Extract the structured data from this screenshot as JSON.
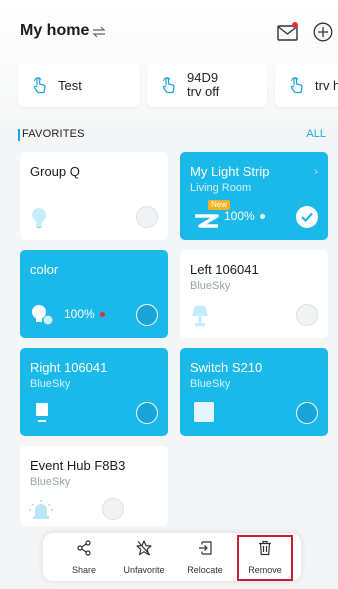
{
  "header": {
    "title": "My home",
    "icons": [
      "swap-icon",
      "mail-icon",
      "add-icon"
    ],
    "notification_color": "#e8302e"
  },
  "scenes": [
    {
      "label_line1": "Test",
      "label_line2": ""
    },
    {
      "label_line1": "94D9",
      "label_line2": "trv off"
    },
    {
      "label_line1": "trv h",
      "label_line2": ""
    }
  ],
  "favorites": {
    "title": "FAVORITES",
    "all_label": "ALL",
    "accent": "#1aa8e0",
    "cards": [
      {
        "name": "Group Q",
        "room": "",
        "on": false,
        "percent": ""
      },
      {
        "name": "My Light Strip",
        "room": "Living Room",
        "on": true,
        "percent": "100%",
        "badge": "New",
        "selected": true
      },
      {
        "name": "color",
        "room": "",
        "on": true,
        "percent": "100%"
      },
      {
        "name": "Left 106041",
        "room": "BlueSky",
        "on": false,
        "percent": ""
      },
      {
        "name": "Right 106041",
        "room": "BlueSky",
        "on": true,
        "percent": ""
      },
      {
        "name": "Switch S210",
        "room": "BlueSky",
        "on": true,
        "percent": ""
      },
      {
        "name": "Event Hub F8B3",
        "room": "BlueSky",
        "on": false,
        "percent": ""
      }
    ]
  },
  "actions": {
    "share": "Share",
    "unfavorite": "Unfavorite",
    "relocate": "Relocate",
    "remove": "Remove",
    "highlight_color": "#c41e34"
  }
}
